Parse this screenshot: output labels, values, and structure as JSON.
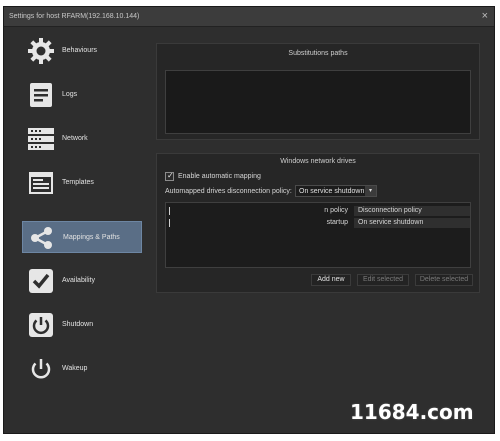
{
  "window": {
    "title": "Settings for host RFARM(192.168.10.144)"
  },
  "sidebar": {
    "items": [
      {
        "label": "Behaviours",
        "icon": "gear-icon"
      },
      {
        "label": "Logs",
        "icon": "logs-icon"
      },
      {
        "label": "Network",
        "icon": "network-icon"
      },
      {
        "label": "Templates",
        "icon": "templates-icon"
      },
      {
        "label": "Mappings & Paths",
        "icon": "mappings-icon",
        "active": true
      },
      {
        "label": "Availability",
        "icon": "checkmark-icon"
      },
      {
        "label": "Shutdown",
        "icon": "power-icon"
      },
      {
        "label": "Wakeup",
        "icon": "power-icon"
      }
    ]
  },
  "substitutions": {
    "title": "Substitutions paths"
  },
  "drives": {
    "title": "Windows network drives",
    "enable_label": "Enable automatic mapping",
    "enable_checked": true,
    "policy_label": "Automapped drives disconnection policy:",
    "policy_value": "On service shutdown",
    "rows": [
      {
        "col1": "n policy",
        "col2": "Disconnection policy"
      },
      {
        "col1": "startup",
        "col2": "On service shutdown"
      }
    ],
    "buttons": {
      "add": "Add new",
      "edit": "Edit selected",
      "delete": "Delete selected"
    }
  },
  "watermark": {
    "text": "11684.com"
  },
  "colors": {
    "active_nav": "#5a6e86",
    "background": "#2e2e2e",
    "watermark_green": "#49a34a"
  }
}
